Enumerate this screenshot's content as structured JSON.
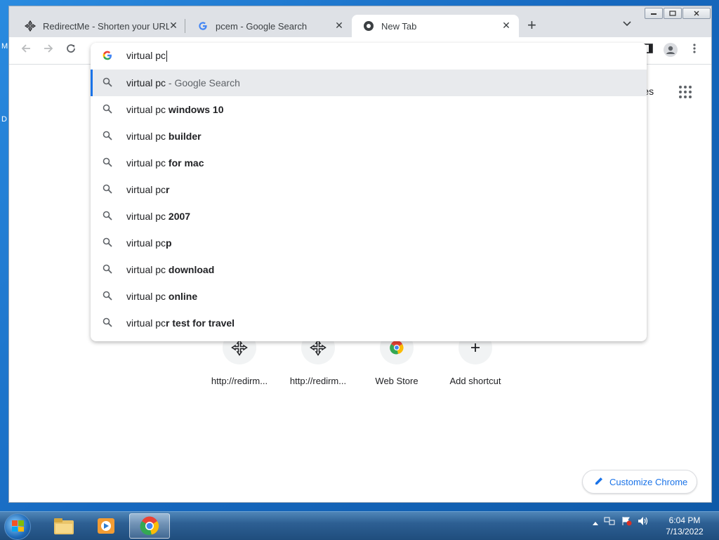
{
  "browser": {
    "tabs": [
      {
        "title": "RedirectMe - Shorten your URL fo",
        "icon": "redirectme-favicon",
        "active": false
      },
      {
        "title": "pcem - Google Search",
        "icon": "google-favicon",
        "active": false
      },
      {
        "title": "New Tab",
        "icon": "chrome-favicon",
        "active": true
      }
    ],
    "new_tab_label": "+",
    "tab_close_label": "✕",
    "omnibox": {
      "value": "virtual pc",
      "suggestions": [
        {
          "prefix": "virtual pc",
          "bold": "",
          "suffix": " - Google Search",
          "selected": true
        },
        {
          "prefix": "virtual pc ",
          "bold": "windows 10",
          "suffix": ""
        },
        {
          "prefix": "virtual pc ",
          "bold": "builder",
          "suffix": ""
        },
        {
          "prefix": "virtual pc ",
          "bold": "for mac",
          "suffix": ""
        },
        {
          "prefix": "virtual pc",
          "bold": "r",
          "suffix": ""
        },
        {
          "prefix": "virtual pc ",
          "bold": "2007",
          "suffix": ""
        },
        {
          "prefix": "virtual pc",
          "bold": "p",
          "suffix": ""
        },
        {
          "prefix": "virtual pc ",
          "bold": "download",
          "suffix": ""
        },
        {
          "prefix": "virtual pc ",
          "bold": "online",
          "suffix": ""
        },
        {
          "prefix": "virtual pc",
          "bold": "r test for travel",
          "suffix": ""
        }
      ]
    },
    "ntp": {
      "images_link": "nages",
      "shortcuts": [
        {
          "label": "http://redirm...",
          "icon": "redirectme-icon"
        },
        {
          "label": "http://redirm...",
          "icon": "redirectme-icon"
        },
        {
          "label": "Web Store",
          "icon": "chrome-webstore-icon"
        },
        {
          "label": "Add shortcut",
          "icon": "plus-icon"
        }
      ],
      "customize_label": "Customize Chrome"
    }
  },
  "desktop": {
    "edge_letters": [
      "M",
      "D"
    ]
  },
  "taskbar": {
    "clock_time": "6:04 PM",
    "clock_date": "7/13/2022"
  },
  "colors": {
    "accent": "#1a73e8",
    "desktop_blue": "#1f78c9"
  }
}
